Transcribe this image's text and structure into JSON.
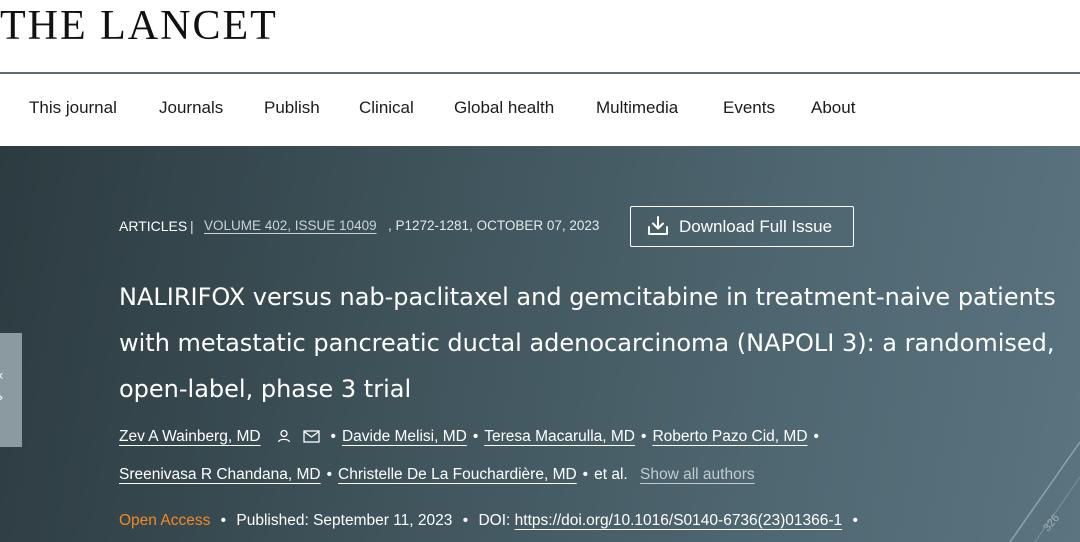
{
  "brand": {
    "logo_text": "THE LANCET"
  },
  "nav": {
    "items": [
      {
        "label": "This journal"
      },
      {
        "label": "Journals"
      },
      {
        "label": "Publish"
      },
      {
        "label": "Clinical"
      },
      {
        "label": "Global health"
      },
      {
        "label": "Multimedia"
      },
      {
        "label": "Events"
      },
      {
        "label": "About"
      }
    ]
  },
  "article": {
    "type_label": "ARTICLES",
    "separator": "|",
    "volume_issue": "VOLUME 402, ISSUE 10409",
    "pages_date": ", P1272-1281, OCTOBER 07, 2023",
    "download_label": "Download Full Issue",
    "title": "NALIRIFOX versus nab-paclitaxel and gemcitabine in treatment-naive patients with metastatic pancreatic ductal adenocarcinoma (NAPOLI 3): a randomised, open-label, phase 3 trial",
    "authors": [
      "Zev A Wainberg, MD",
      "Davide Melisi, MD",
      "Teresa Macarulla, MD",
      "Roberto Pazo Cid, MD",
      "Sreenivasa R Chandana, MD",
      "Christelle De La Fouchardière, MD"
    ],
    "et_al": "et al.",
    "show_all_label": "Show all authors",
    "open_access_label": "Open Access",
    "published_label": "Published: September 11, 2023",
    "doi_label": "DOI:",
    "doi_url": "https://doi.org/10.1016/S0140-6736(23)01366-1",
    "cover_number": "326"
  },
  "colors": {
    "hero_dark": "#2c3b40",
    "hero_light": "#5a7480",
    "open_access": "#f08a24",
    "nav_border": "#5a6e76"
  },
  "icons": [
    "person-icon",
    "mail-icon",
    "download-icon"
  ]
}
